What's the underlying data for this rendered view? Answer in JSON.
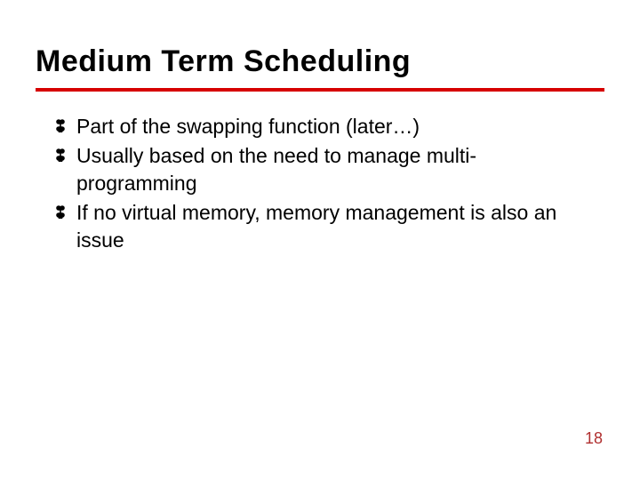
{
  "slide": {
    "title": "Medium Term Scheduling",
    "bullets": [
      "Part of the swapping function (later…)",
      "Usually based on the need to manage multi-programming",
      "If no virtual memory, memory management is also an issue"
    ],
    "page_number": "18",
    "accent_color": "#d60000",
    "pagenum_color": "#b03030"
  }
}
